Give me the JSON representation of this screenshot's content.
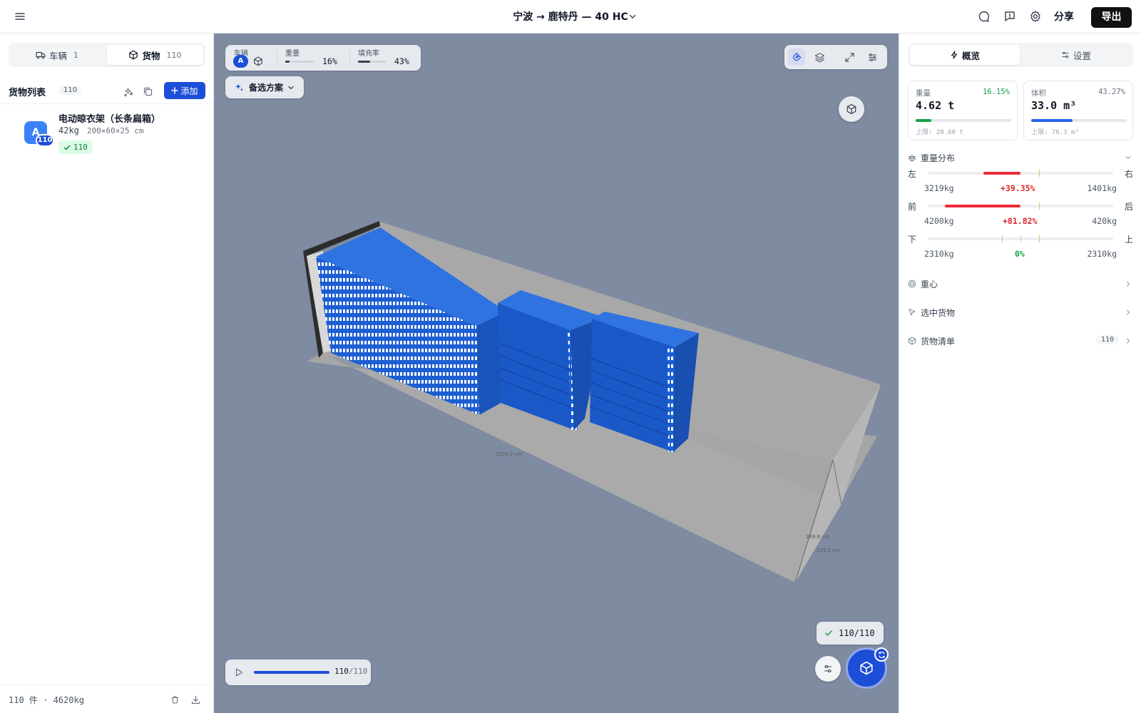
{
  "header": {
    "title": "宁波 → 鹿特丹 — 40 HC",
    "share_label": "分享",
    "export_label": "导出"
  },
  "left": {
    "tabs": [
      {
        "label": "车辆",
        "count": "1",
        "icon": "truck-icon"
      },
      {
        "label": "货物",
        "count": "110",
        "icon": "box-icon"
      }
    ],
    "active_tab": 1,
    "list_title": "货物列表",
    "list_count": "110",
    "add_label": "添加",
    "items": [
      {
        "avatar": "A",
        "badge": "110",
        "name": "电动晾衣架（长条扁箱）",
        "weight": "42kg",
        "dims": "200×60×25 cm",
        "tag": "110",
        "color": "#3b82f6"
      }
    ],
    "footer": "110 件 · 4620kg"
  },
  "viewport": {
    "vehicle_label": "车辆",
    "vehicle_id": "A",
    "weight_label": "重量",
    "weight_pct": "16%",
    "weight_fraction": 0.16,
    "fill_label": "填充率",
    "fill_pct": "43%",
    "fill_fraction": 0.43,
    "alt_label": "备选方案",
    "done_text": "110/110",
    "play_done": "110",
    "play_total": "/110",
    "play_fraction": 1.0,
    "dim_labels": {
      "length": "1203.2 cm",
      "width": "235.2 cm",
      "height": "269.8 cm"
    },
    "box_color": "#1d63d8",
    "background": "#7e8ba1"
  },
  "right": {
    "tabs": [
      {
        "label": "概览",
        "icon": "lightning-icon"
      },
      {
        "label": "设置",
        "icon": "sliders-icon"
      }
    ],
    "weight_card": {
      "label": "重量",
      "pct": "16.15%",
      "value": "4.62 t",
      "limit": "上限: 28.60 t",
      "fraction": 0.1615,
      "color": "#16a34a"
    },
    "volume_card": {
      "label": "体积",
      "pct": "43.27%",
      "value": "33.0 m³",
      "limit": "上限: 76.3 m³",
      "fraction": 0.4327,
      "color": "#2563eb"
    },
    "dist_title": "重量分布",
    "distribution": [
      {
        "left": "左",
        "right": "右",
        "left_value": "3219kg",
        "right_value": "1401kg",
        "pct": "+39.35%",
        "status": "warn"
      },
      {
        "left": "前",
        "right": "后",
        "left_value": "4200kg",
        "right_value": "420kg",
        "pct": "+81.82%",
        "status": "warn"
      },
      {
        "left": "下",
        "right": "上",
        "left_value": "2310kg",
        "right_value": "2310kg",
        "pct": "0%",
        "status": "ok"
      }
    ],
    "sections": [
      {
        "label": "重心",
        "icon": "target-icon"
      },
      {
        "label": "选中货物",
        "icon": "cursor-icon"
      },
      {
        "label": "货物清单",
        "icon": "box-icon",
        "count": "110"
      }
    ]
  }
}
